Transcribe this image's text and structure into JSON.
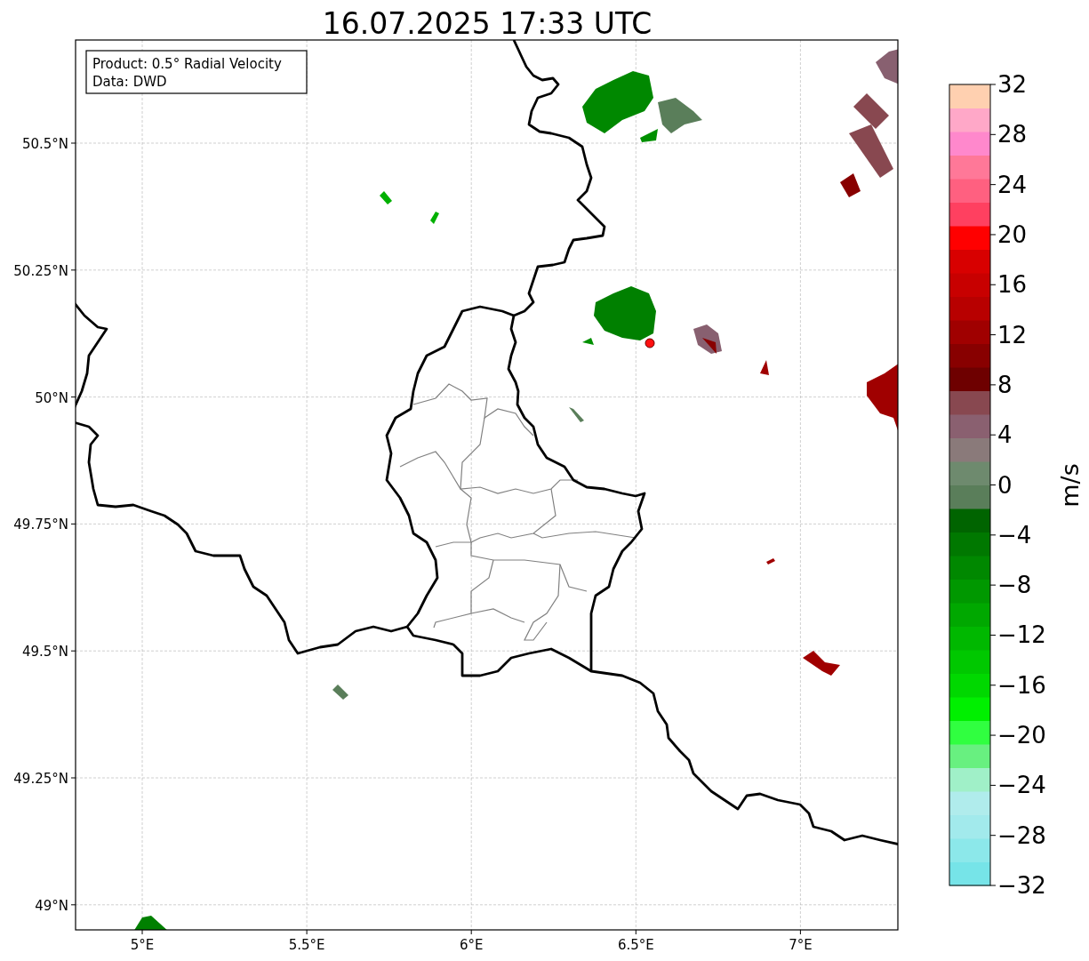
{
  "title": "16.07.2025 17:33 UTC",
  "info_box": [
    "Product: 0.5° Radial Velocity",
    "Data: DWD"
  ],
  "x_axis": {
    "tick_labels": [
      "5°E",
      "5.5°E",
      "6°E",
      "6.5°E",
      "7°E"
    ]
  },
  "y_axis": {
    "tick_labels": [
      "50.5°N",
      "50.25°N",
      "50°N",
      "49.75°N",
      "49.5°N",
      "49.25°N",
      "49°N"
    ]
  },
  "colorbar": {
    "label": "m/s",
    "tick_labels": [
      "32",
      "28",
      "24",
      "20",
      "16",
      "12",
      "8",
      "4",
      "0",
      "−4",
      "−8",
      "−12",
      "−16",
      "−20",
      "−24",
      "−28",
      "−32"
    ],
    "bands": [
      {
        "color": "#76e4e8"
      },
      {
        "color": "#8ce8ea"
      },
      {
        "color": "#a2eaec"
      },
      {
        "color": "#b0ecec"
      },
      {
        "color": "#a0f0c8"
      },
      {
        "color": "#68f080"
      },
      {
        "color": "#30ff40"
      },
      {
        "color": "#00f000"
      },
      {
        "color": "#00d800"
      },
      {
        "color": "#00c800"
      },
      {
        "color": "#00b800"
      },
      {
        "color": "#00a800"
      },
      {
        "color": "#009800"
      },
      {
        "color": "#008800"
      },
      {
        "color": "#007800"
      },
      {
        "color": "#006400"
      },
      {
        "color": "#5a7e5a"
      },
      {
        "color": "#6e8a6e"
      },
      {
        "color": "#8a7a7a"
      },
      {
        "color": "#8a6070"
      },
      {
        "color": "#884850"
      },
      {
        "color": "#6e0000"
      },
      {
        "color": "#880000"
      },
      {
        "color": "#a00000"
      },
      {
        "color": "#b80000"
      },
      {
        "color": "#c80000"
      },
      {
        "color": "#d80000"
      },
      {
        "color": "#ff0000"
      },
      {
        "color": "#ff4060"
      },
      {
        "color": "#ff6080"
      },
      {
        "color": "#ff7898"
      },
      {
        "color": "#ff88cc"
      },
      {
        "color": "#ffa8c8"
      },
      {
        "color": "#ffd0b0"
      }
    ]
  }
}
